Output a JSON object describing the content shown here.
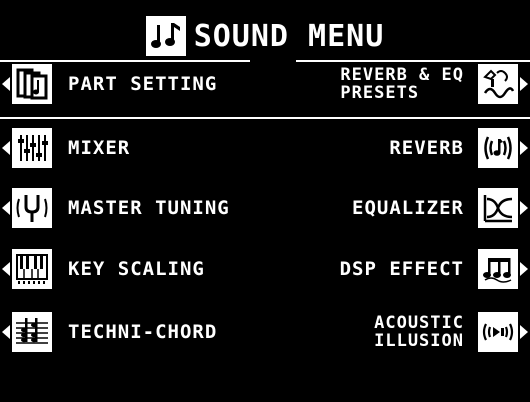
{
  "header": {
    "title": "SOUND MENU",
    "icon": "music-notes-icon"
  },
  "left_items": [
    {
      "label": "PART SETTING",
      "icon": "part-setting-icon"
    },
    {
      "label": "MIXER",
      "icon": "mixer-icon"
    },
    {
      "label": "MASTER TUNING",
      "icon": "tuning-fork-icon"
    },
    {
      "label": "KEY SCALING",
      "icon": "key-scaling-icon"
    },
    {
      "label": "TECHNI-CHORD",
      "icon": "techni-chord-icon"
    }
  ],
  "right_items": [
    {
      "line1": "REVERB & EQ",
      "line2": "PRESETS",
      "icon": "reverb-eq-presets-icon"
    },
    {
      "label": "REVERB",
      "icon": "reverb-icon"
    },
    {
      "label": "EQUALIZER",
      "icon": "equalizer-icon"
    },
    {
      "label": "DSP EFFECT",
      "icon": "dsp-effect-icon"
    },
    {
      "line1": "ACOUSTIC",
      "line2": "ILLUSION",
      "icon": "acoustic-illusion-icon"
    }
  ],
  "colors": {
    "background": "#000000",
    "foreground": "#ffffff"
  }
}
